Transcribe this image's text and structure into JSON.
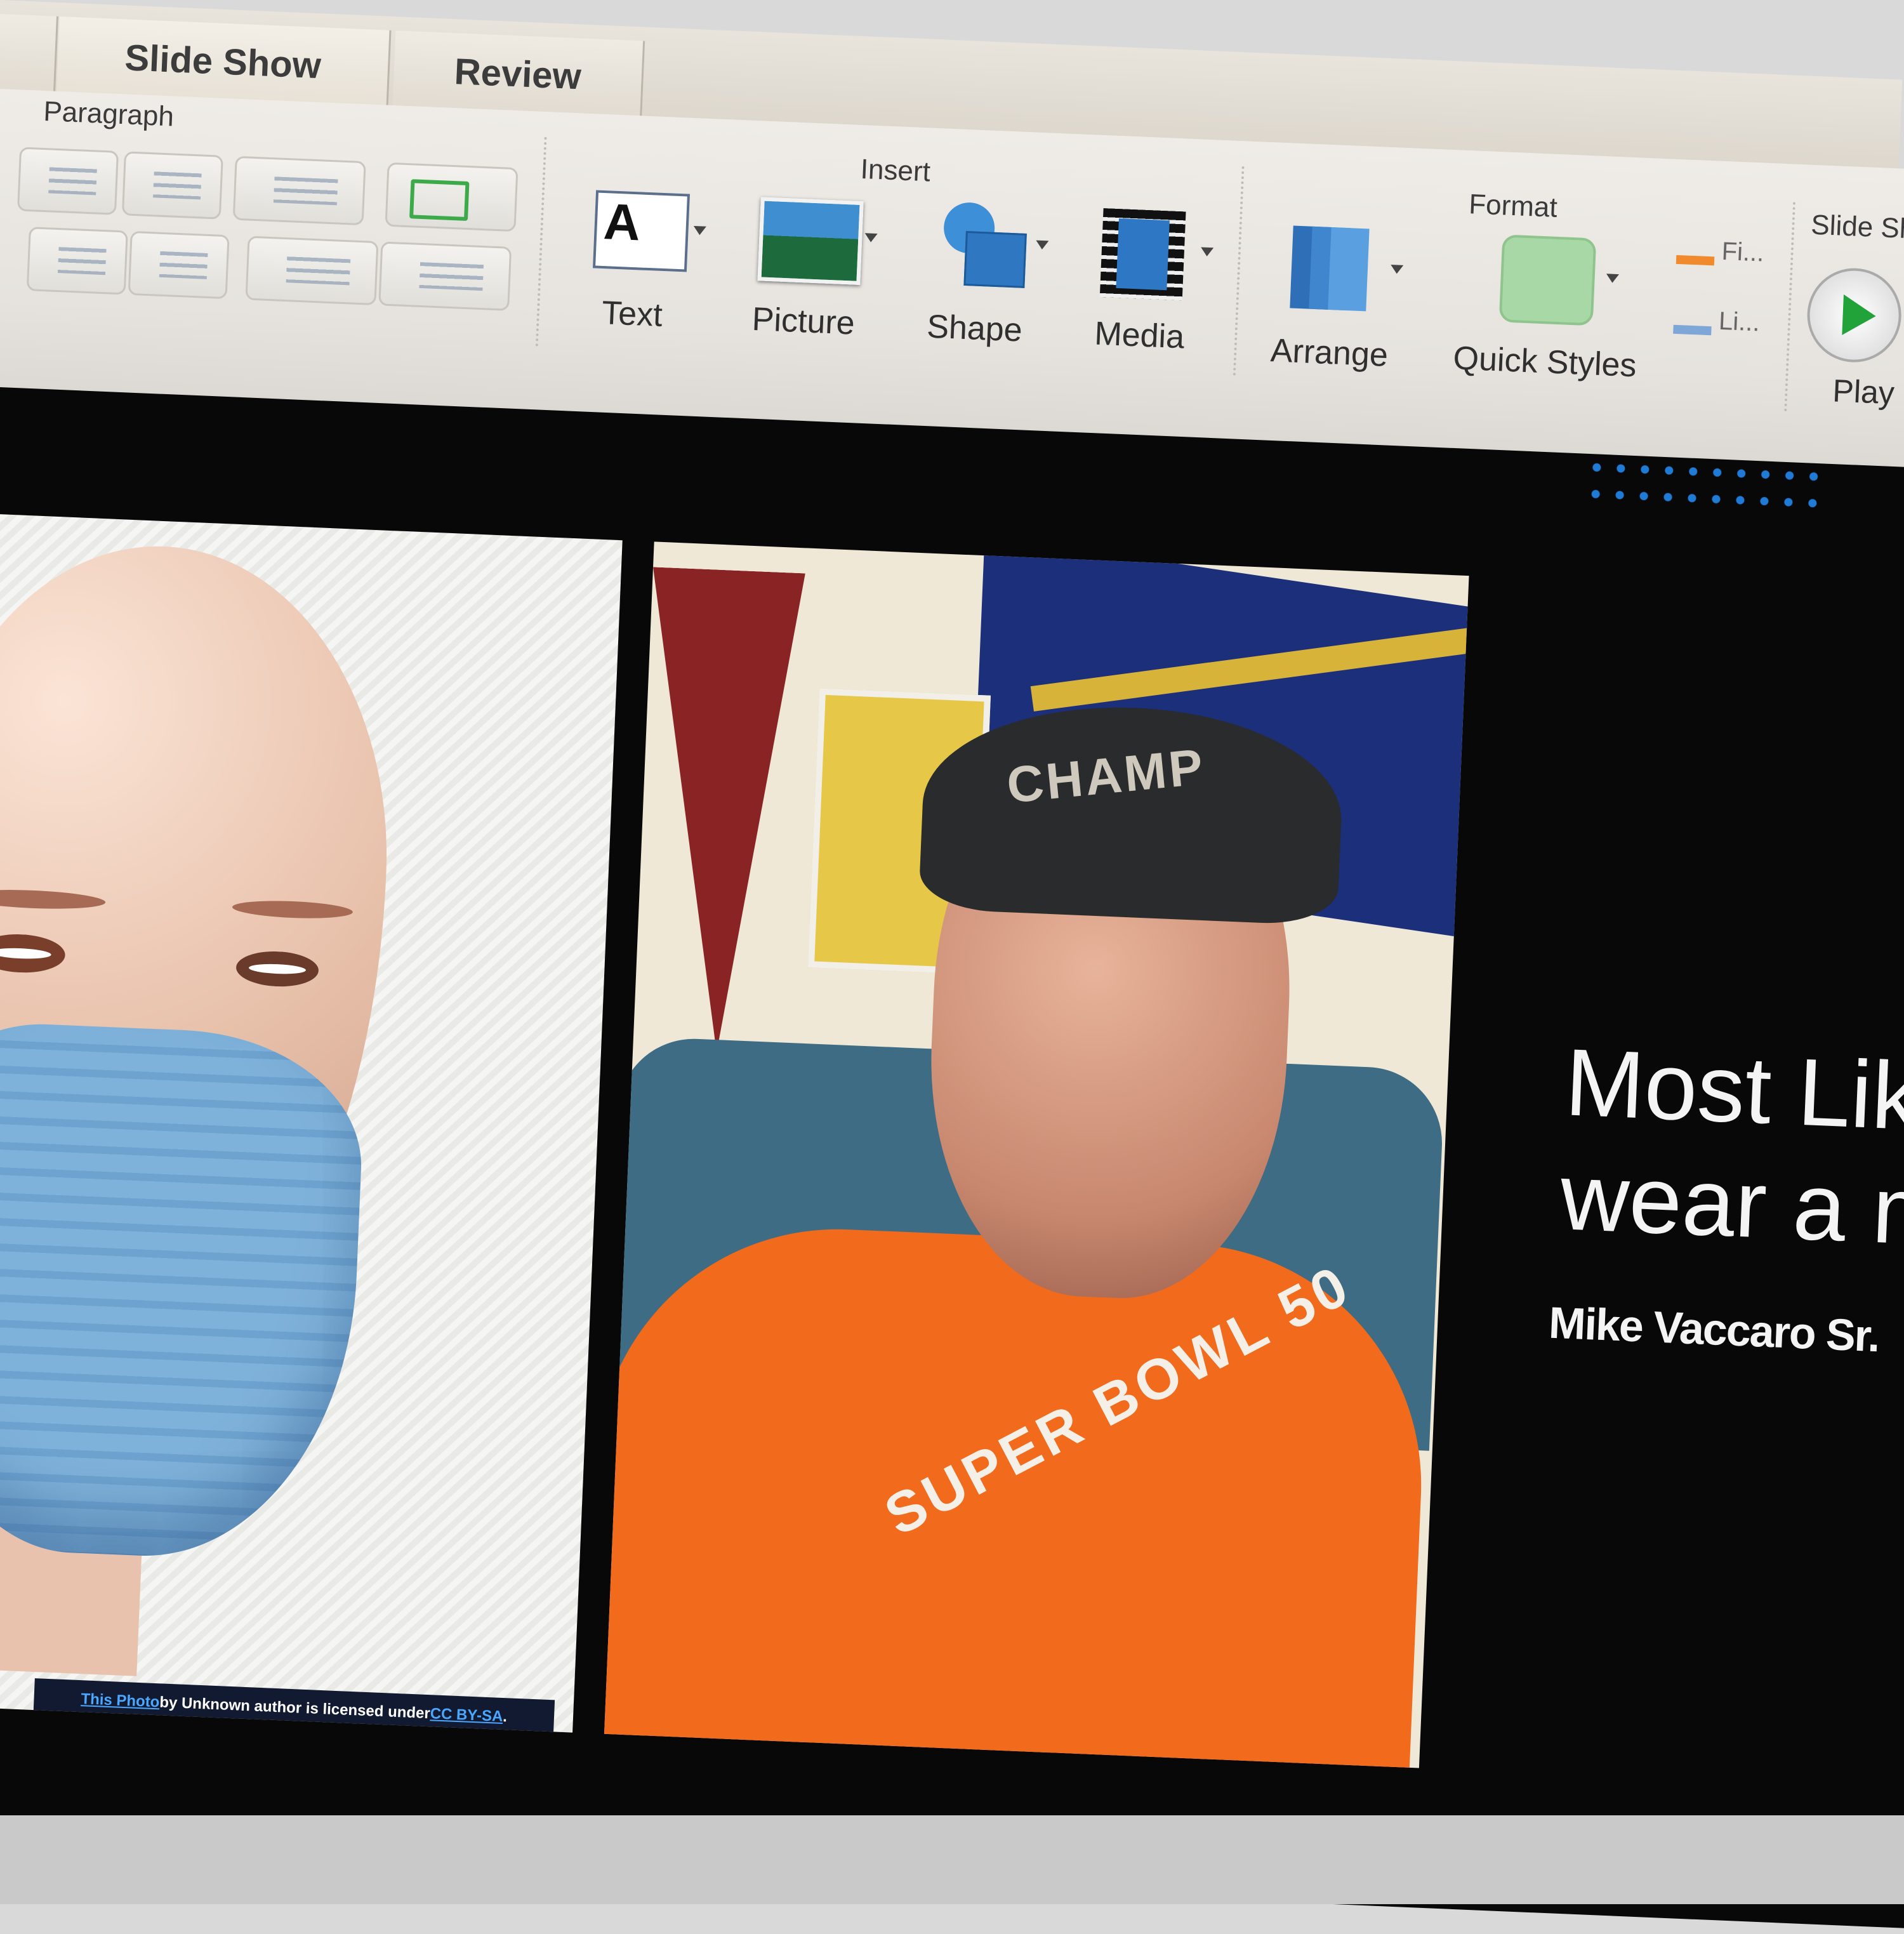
{
  "ribbon": {
    "tabs": [
      "Slide Show",
      "Review"
    ],
    "groups": {
      "paragraph": "Paragraph",
      "insert": "Insert",
      "format": "Format",
      "slide_show": "Slide Sh"
    },
    "insert_buttons": [
      {
        "label": "Text",
        "icon": "text-box-icon"
      },
      {
        "label": "Picture",
        "icon": "picture-icon"
      },
      {
        "label": "Shape",
        "icon": "shape-icon"
      },
      {
        "label": "Media",
        "icon": "media-icon"
      }
    ],
    "format_buttons": [
      {
        "label": "Arrange",
        "icon": "arrange-icon"
      },
      {
        "label": "Quick Styles",
        "icon": "quick-styles-icon"
      }
    ],
    "format_small": [
      "Fi...",
      "Li..."
    ],
    "play_label": "Play"
  },
  "slide": {
    "title_line1": "Most Lik",
    "title_line2": "wear a m",
    "author": "Mike Vaccaro Sr.",
    "left_photo_caption": {
      "link_text": "This Photo",
      "middle": " by Unknown author is licensed under ",
      "license": "CC BY-SA",
      "end": "."
    },
    "cap_text": "CHAMP",
    "shirt_text": "SUPER BOWL 50"
  },
  "colors": {
    "accent_blue": "#1f7bd6",
    "shirt_orange": "#f26a1c",
    "play_green": "#21a33a"
  }
}
